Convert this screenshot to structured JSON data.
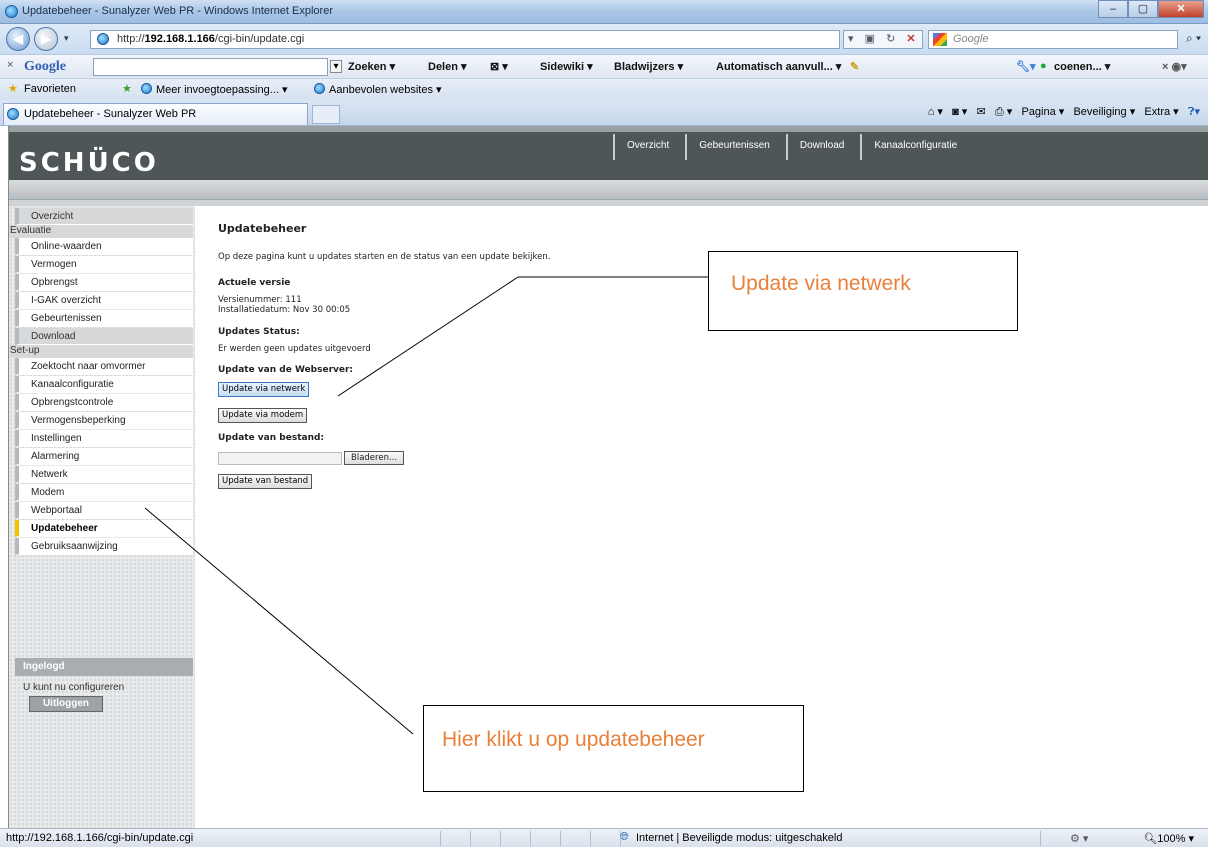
{
  "window": {
    "title": "Updatebeheer - Sunalyzer Web PR - Windows Internet Explorer",
    "minimize": "–",
    "maximize": "▢",
    "close": "✕"
  },
  "address": {
    "url_prefix": "http://",
    "url_host": "192.168.1.166",
    "url_path": "/cgi-bin/update.cgi",
    "search_placeholder": "Google"
  },
  "google_toolbar": {
    "logo": "Google",
    "close": "×",
    "items": [
      "Zoeken ▾",
      "Delen ▾",
      "Sidewiki ▾",
      "Bladwijzers ▾",
      "Automatisch aanvull... ▾",
      "coenen... ▾"
    ]
  },
  "favorites": {
    "label": "Favorieten",
    "items": [
      "Meer invoegtoepassing... ▾",
      "Aanbevolen websites ▾"
    ]
  },
  "tab": {
    "title": "Updatebeheer - Sunalyzer Web PR",
    "commands": [
      "Pagina ▾",
      "Beveiliging ▾",
      "Extra ▾"
    ]
  },
  "site": {
    "logo": "SCHÜCO",
    "topnav": [
      "Overzicht",
      "Gebeurtenissen",
      "Download",
      "Kanaalconfiguratie"
    ]
  },
  "sidebar": {
    "overzicht": "Overzicht",
    "evaluatie_header": "Evaluatie",
    "evaluatie": [
      "Online-waarden",
      "Vermogen",
      "Opbrengst",
      "I-GAK overzicht",
      "Gebeurtenissen"
    ],
    "download": "Download",
    "setup_header": "Set-up",
    "setup": [
      "Zoektocht naar omvormer",
      "Kanaalconfiguratie",
      "Opbrengstcontrole",
      "Vermogensbeperking",
      "Instellingen",
      "Alarmering",
      "Netwerk",
      "Modem",
      "Webportaal",
      "Updatebeheer",
      "Gebruiksaanwijzing"
    ],
    "login_header": "Ingelogd",
    "login_text": "U kunt nu configureren",
    "logout": "Uitloggen"
  },
  "content": {
    "title": "Updatebeheer",
    "intro": "Op deze pagina kunt u updates starten en de status van een update bekijken.",
    "current_version_heading": "Actuele versie",
    "version": "Versienummer: 111",
    "install_date": "Installatiedatum: Nov 30 00:05",
    "status_heading": "Updates Status:",
    "status_text": "Er werden geen updates uitgevoerd",
    "webserver_heading": "Update van de Webserver:",
    "btn_network": "Update via netwerk",
    "btn_modem": "Update via modem",
    "file_heading": "Update van bestand:",
    "btn_browse": "Bladeren...",
    "btn_file": "Update van bestand"
  },
  "callouts": {
    "network": "Update via netwerk",
    "sidebar": "Hier klikt u op updatebeheer"
  },
  "statusbar": {
    "url": "http://192.168.1.166/cgi-bin/update.cgi",
    "zone": "Internet | Beveiligde modus: uitgeschakeld",
    "zoom": "100%"
  }
}
